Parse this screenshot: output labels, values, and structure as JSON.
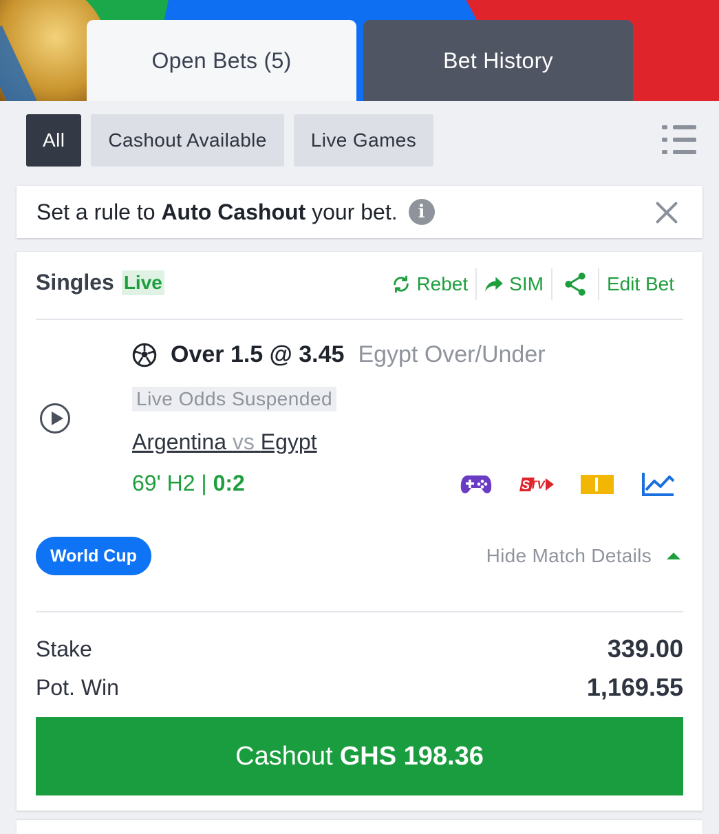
{
  "tabs": {
    "open_bets": "Open Bets (5)",
    "bet_history": "Bet History"
  },
  "filters": {
    "all": "All",
    "cashout_available": "Cashout Available",
    "live_games": "Live Games"
  },
  "auto_cashout": {
    "prefix": "Set a rule to",
    "bold": "Auto Cashout",
    "suffix": "your bet.",
    "info_glyph": "i"
  },
  "bet": {
    "type": "Singles",
    "live_label": "Live",
    "actions": {
      "rebet": "Rebet",
      "sim": "SIM",
      "edit": "Edit Bet"
    },
    "pick": "Over 1.5 @ 3.45",
    "market": "Egypt Over/Under",
    "status": "Live Odds Suspended",
    "home_team": "Argentina",
    "vs": "vs",
    "away_team": "Egypt",
    "match_time": "69' H2 | ",
    "score": "0:2",
    "competition": "World Cup",
    "hide_details": "Hide Match Details",
    "stake_label": "Stake",
    "stake_value": "339.00",
    "pot_win_label": "Pot. Win",
    "pot_win_value": "1,169.55",
    "cashout_prefix": "Cashout",
    "cashout_amount": "GHS 198.36"
  },
  "colors": {
    "green": "#1a9d3e",
    "blue": "#0f73f5",
    "dark_tab": "#4f5562",
    "chip_active": "#343a45"
  },
  "icons": [
    "list-view-icon",
    "info-icon",
    "close-icon",
    "refresh-icon",
    "forward-arrow-icon",
    "share-icon",
    "play-icon",
    "soccer-ball-icon",
    "gamepad-icon",
    "stv-icon",
    "ticket-icon",
    "stats-chart-icon",
    "caret-up-icon"
  ]
}
